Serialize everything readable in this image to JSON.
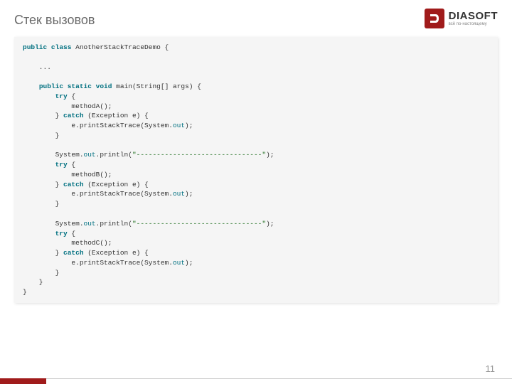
{
  "title": "Стек вызовов",
  "logo": {
    "name": "DIASOFT",
    "tag": "всё по-настоящему"
  },
  "page_number": "11",
  "code": {
    "l01a": "public",
    "l01b": "class",
    "l01c": " AnotherStackTraceDemo {",
    "l02": "",
    "l03": "    ...",
    "l04": "",
    "l05a": "    ",
    "l05b": "public",
    "l05c": " ",
    "l05d": "static",
    "l05e": " ",
    "l05f": "void",
    "l05g": " main(String[] args) {",
    "l06a": "        ",
    "l06b": "try",
    "l06c": " {",
    "l07": "            methodA();",
    "l08a": "        } ",
    "l08b": "catch",
    "l08c": " (Exception e) {",
    "l09a": "            e.printStackTrace(System.",
    "l09b": "out",
    "l09c": ");",
    "l10": "        }",
    "l11": "",
    "l12a": "        System.",
    "l12b": "out",
    "l12c": ".println(",
    "l12d": "\"-------------------------------\"",
    "l12e": ");",
    "l13a": "        ",
    "l13b": "try",
    "l13c": " {",
    "l14": "            methodB();",
    "l15a": "        } ",
    "l15b": "catch",
    "l15c": " (Exception e) {",
    "l16a": "            e.printStackTrace(System.",
    "l16b": "out",
    "l16c": ");",
    "l17": "        }",
    "l18": "",
    "l19a": "        System.",
    "l19b": "out",
    "l19c": ".println(",
    "l19d": "\"-------------------------------\"",
    "l19e": ");",
    "l20a": "        ",
    "l20b": "try",
    "l20c": " {",
    "l21": "            methodC();",
    "l22a": "        } ",
    "l22b": "catch",
    "l22c": " (Exception e) {",
    "l23a": "            e.printStackTrace(System.",
    "l23b": "out",
    "l23c": ");",
    "l24": "        }",
    "l25": "    }",
    "l26": "}"
  }
}
